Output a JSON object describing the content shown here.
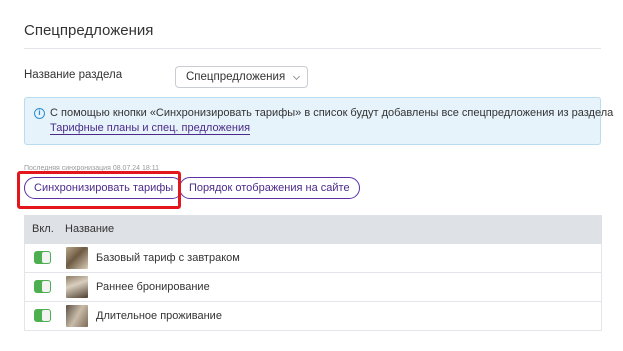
{
  "header": {
    "title": "Спецпредложения"
  },
  "section": {
    "label": "Название раздела",
    "selected": "Спецпредложения"
  },
  "info": {
    "icon": "info-icon",
    "text": "С помощью кнопки «Синхронизировать тарифы» в список будут добавлены все спецпредложения из раздела",
    "link": "Тарифные планы и спец. предложения"
  },
  "sync": {
    "last_sync": "Последняя синхронизация 08.07.24 18:11",
    "sync_button": "Синхронизировать тарифы",
    "order_button": "Порядок отображения на сайте"
  },
  "colors": {
    "accent": "#4b2a8a",
    "toggle_on": "#4caf50",
    "highlight": "#e3161e",
    "info_bg": "#e6f3fa"
  },
  "table": {
    "headers": {
      "enabled": "Вкл.",
      "name": "Название"
    },
    "rows": [
      {
        "enabled": true,
        "name": "Базовый тариф с завтраком"
      },
      {
        "enabled": true,
        "name": "Раннее бронирование"
      },
      {
        "enabled": true,
        "name": "Длительное проживание"
      }
    ]
  }
}
